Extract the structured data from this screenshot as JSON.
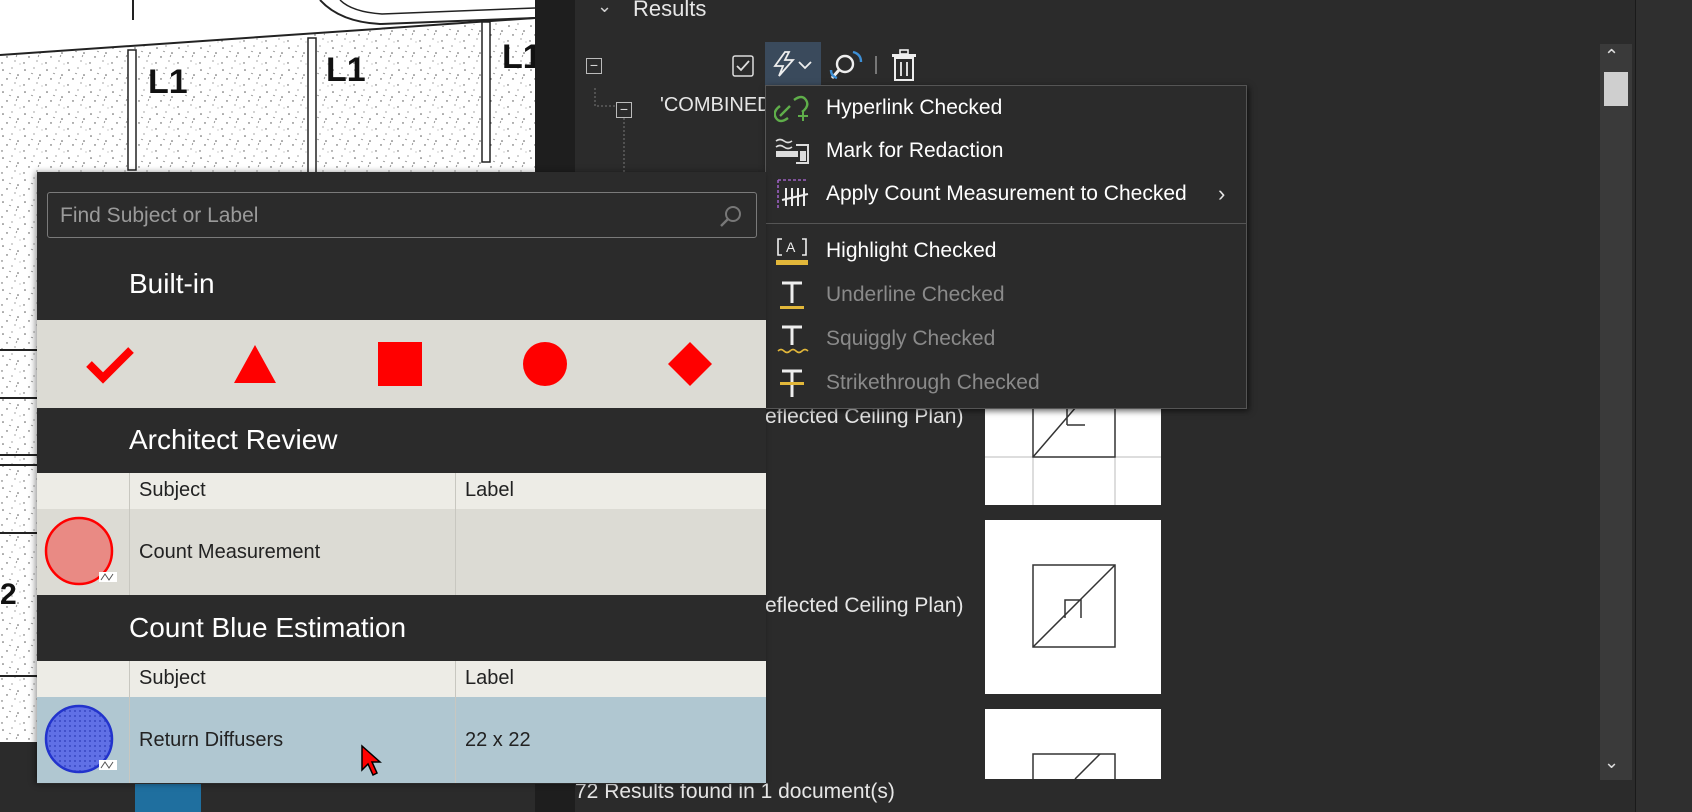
{
  "drawing": {
    "labels": [
      "L1",
      "L1",
      "L1"
    ],
    "side_label": "2"
  },
  "results": {
    "title": "Results",
    "combined": "'COMBINED",
    "plan_labels": [
      "eflected Ceiling Plan)",
      "eflected Ceiling Plan)"
    ],
    "status": "72 Results found in 1 document(s)"
  },
  "toolbar": {
    "icons": [
      "checkbox-icon",
      "lightning-dropdown-icon",
      "search-replace-icon",
      "trash-icon"
    ]
  },
  "menu": {
    "items": [
      {
        "label": "Hyperlink Checked",
        "icon": "hyperlink-icon",
        "enabled": true
      },
      {
        "label": "Mark for Redaction",
        "icon": "redaction-icon",
        "enabled": true
      },
      {
        "label": "Apply Count Measurement to Checked",
        "icon": "count-measurement-icon",
        "enabled": true,
        "submenu": true
      },
      {
        "label": "Highlight Checked",
        "icon": "highlight-icon",
        "enabled": true
      },
      {
        "label": "Underline Checked",
        "icon": "underline-icon",
        "enabled": false
      },
      {
        "label": "Squiggly Checked",
        "icon": "squiggly-icon",
        "enabled": false
      },
      {
        "label": "Strikethrough Checked",
        "icon": "strikethrough-icon",
        "enabled": false
      }
    ],
    "submenu_arrow": "›"
  },
  "chest": {
    "search_placeholder": "Find Subject or Label",
    "sections": [
      {
        "title": "Built-in",
        "shapes": [
          "checkmark",
          "triangle",
          "square",
          "circle",
          "diamond"
        ],
        "shape_color": "#ff0000"
      },
      {
        "title": "Architect Review",
        "headers": {
          "subject": "Subject",
          "label": "Label"
        },
        "rows": [
          {
            "subject": "Count Measurement",
            "label": "",
            "color": "#e98a84"
          }
        ]
      },
      {
        "title": "Count Blue Estimation",
        "headers": {
          "subject": "Subject",
          "label": "Label"
        },
        "rows": [
          {
            "subject": "Return Diffusers",
            "label": "22 x 22",
            "color": "#4a5bdc",
            "selected": true
          }
        ]
      }
    ]
  },
  "colors": {
    "accent": "#3d8fd6",
    "selected_row": "#b0c7d1",
    "dark_bg": "#2b2b2b"
  }
}
